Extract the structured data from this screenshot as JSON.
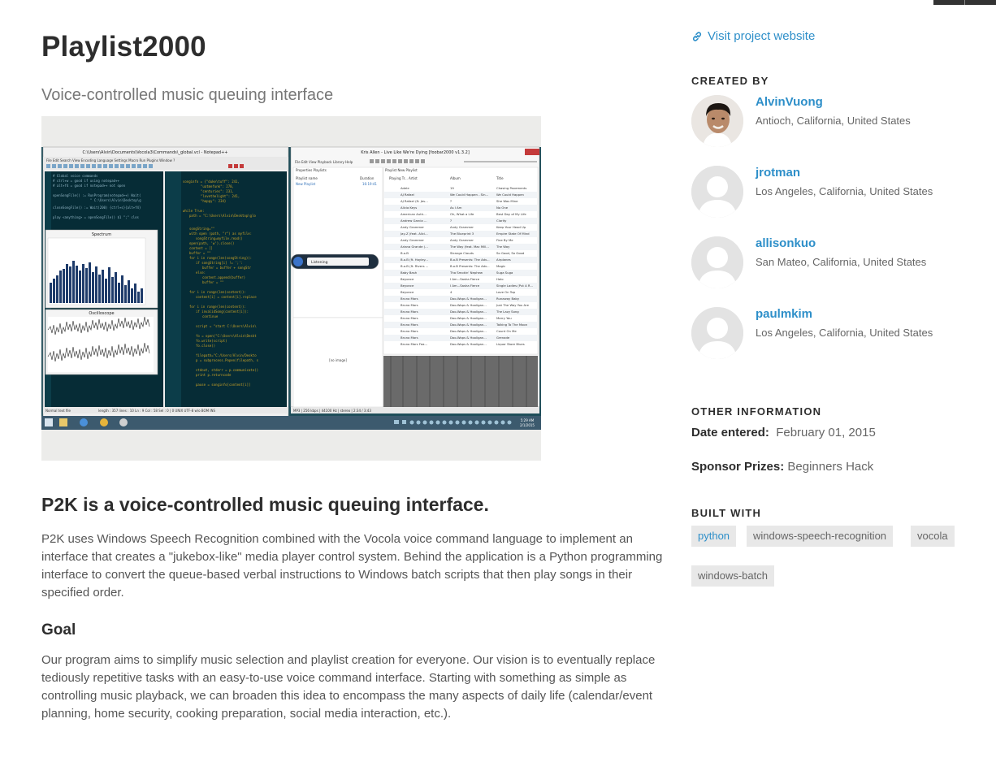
{
  "project": {
    "title": "Playlist2000",
    "tagline": "Voice-controlled music queuing interface"
  },
  "description": {
    "heading": "P2K is a voice-controlled music queuing interface.",
    "intro": "P2K uses Windows Speech Recognition combined with the Vocola voice command language to implement an interface that creates a \"jukebox-like\" media player control system. Behind the application is a Python programming interface to convert the queue-based verbal instructions to Windows batch scripts that then play songs in their specified order.",
    "goal_heading": "Goal",
    "goal_text": "Our program aims to simplify music selection and playlist creation for everyone. Our vision is to eventually replace tediously repetitive tasks with an easy-to-use voice command interface. Starting with something as simple as controlling music playback, we can broaden this idea to encompass the many aspects of daily life (calendar/event planning, home security, cooking preparation, social media interaction, etc.)."
  },
  "screenshot": {
    "notepad_title": "C:\\Users\\Alvin\\Documents\\Vocola3\\Commands\\_global.vcl - Notepad++",
    "foobar_title": "Kris Allen - Live Like We're Dying   [foobar2000 v1.3.2]",
    "spectrum_label": "Spectrum",
    "oscilloscope_label": "Oscilloscope",
    "listening_label": "Listening",
    "no_image_label": "[no image]",
    "status_left": "Normal text file",
    "status_right": "MP3 | 256 kbps | 44100 Hz | stereo | 2:34 / 3:43",
    "clock": "5:29 AM",
    "date": "2/1/2015",
    "playlist_name": "New Playlist",
    "playlist_duration": "16:19:41",
    "tracks": [
      {
        "artist": "Adele",
        "album": "19",
        "title": "Chasing Pavements"
      },
      {
        "artist": "AJ Rafael",
        "album": "We Could Happen - Sin...",
        "title": "We Could Happen"
      },
      {
        "artist": "AJ Rafael (ft. Jes...",
        "album": "?",
        "title": "She Was Mine"
      },
      {
        "artist": "Alicia Keys",
        "album": "As I Am",
        "title": "No One"
      },
      {
        "artist": "American Auth...",
        "album": "Oh, What a Life",
        "title": "Best Day of My Life"
      },
      {
        "artist": "Andrew Garcia ...",
        "album": "?",
        "title": "Clarity"
      },
      {
        "artist": "Andy Grammer",
        "album": "Andy Grammer",
        "title": "Keep Your Head Up"
      },
      {
        "artist": "Jay-Z (feat. Alici...",
        "album": "The Blueprint 3",
        "title": "Empire State Of Mind"
      },
      {
        "artist": "Andy Grammer",
        "album": "Andy Grammer",
        "title": "Fine By Me"
      },
      {
        "artist": "Ariana Grande (...",
        "album": "The Way (feat. Mac Mill...",
        "title": "The Way"
      },
      {
        "artist": "B.o.B",
        "album": "Strange Clouds",
        "title": "So Good, So Good"
      },
      {
        "artist": "B.o.B (ft. Hayley...",
        "album": "B.o.B Presents: The Adv...",
        "title": "Airplanes"
      },
      {
        "artist": "B.o.B (ft. Rivers ...",
        "album": "B.o.B Presents: The Adv...",
        "title": "Magic"
      },
      {
        "artist": "Baby Bash",
        "album": "Tha Smokin' Nephew",
        "title": "Suga Suga"
      },
      {
        "artist": "Beyonce",
        "album": "I Am...Sasha Fierce",
        "title": "Halo"
      },
      {
        "artist": "Beyonce",
        "album": "I Am...Sasha Fierce",
        "title": "Single Ladies (Put A R..."
      },
      {
        "artist": "Beyonce",
        "album": "4",
        "title": "Love On Top"
      },
      {
        "artist": "Bruno Mars",
        "album": "Doo-Wops & Hooligan...",
        "title": "Runaway Baby"
      },
      {
        "artist": "Bruno Mars",
        "album": "Doo-Wops & Hooligan...",
        "title": "Just The Way You Are"
      },
      {
        "artist": "Bruno Mars",
        "album": "Doo-Wops & Hooligan...",
        "title": "The Lazy Song"
      },
      {
        "artist": "Bruno Mars",
        "album": "Doo-Wops & Hooligan...",
        "title": "Marry You"
      },
      {
        "artist": "Bruno Mars",
        "album": "Doo-Wops & Hooligan...",
        "title": "Talking To The Moon"
      },
      {
        "artist": "Bruno Mars",
        "album": "Doo-Wops & Hooligan...",
        "title": "Count On Me"
      },
      {
        "artist": "Bruno Mars",
        "album": "Doo-Wops & Hooligan...",
        "title": "Grenade"
      },
      {
        "artist": "Bruno Mars Fea...",
        "album": "Doo-Wops & Hooligan...",
        "title": "Liquor Store Blues"
      }
    ]
  },
  "sidebar": {
    "visit_link": "Visit project website",
    "created_by_heading": "CREATED BY",
    "members": [
      {
        "name": "AlvinVuong",
        "location": "Antioch, California, United States"
      },
      {
        "name": "jrotman",
        "location": "Los Angeles, California, United States"
      },
      {
        "name": "allisonkuo",
        "location": "San Mateo, California, United States"
      },
      {
        "name": "paulmkim",
        "location": "Los Angeles, California, United States"
      }
    ],
    "other_info_heading": "OTHER INFORMATION",
    "date_label": "Date entered:",
    "date_value": "February 01, 2015",
    "sponsor_label": "Sponsor Prizes:",
    "sponsor_value": "Beginners Hack",
    "built_with_heading": "BUILT WITH",
    "built_with": [
      "python",
      "windows-speech-recognition",
      "vocola",
      "windows-batch"
    ]
  },
  "colors": {
    "link": "#2e8fc9",
    "heading": "#2d2d2d",
    "body_text": "#555555",
    "tag_bg": "#e8e8e8"
  }
}
